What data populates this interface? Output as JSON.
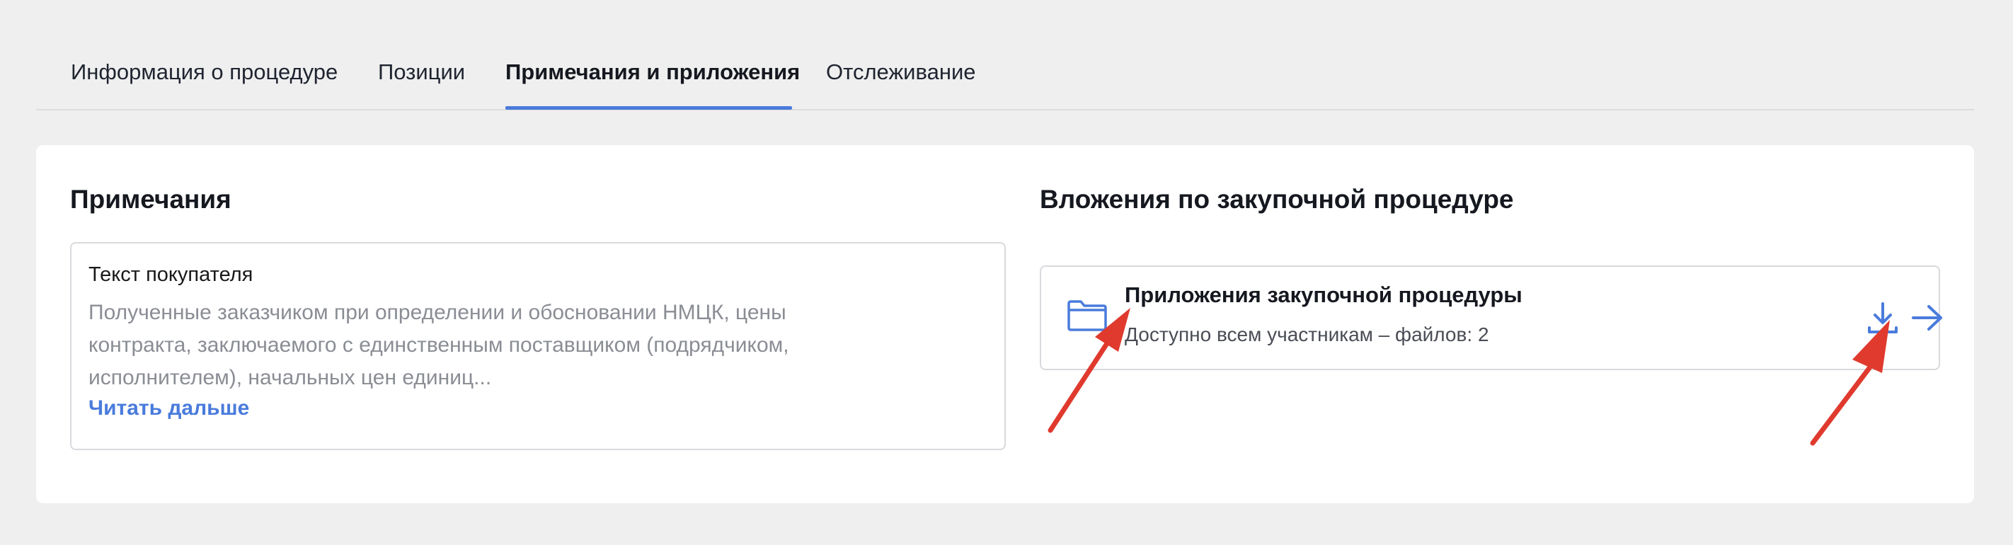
{
  "tabs": [
    {
      "label": "Информация о процедуре"
    },
    {
      "label": "Позиции"
    },
    {
      "label": "Примечания и приложения"
    },
    {
      "label": "Отслеживание"
    }
  ],
  "active_tab_index": 2,
  "notes": {
    "title": "Примечания",
    "label": "Текст покупателя",
    "text_lines": [
      "Полученные заказчиком при определении и обосновании НМЦК, цены",
      "контракта, заключаемого с единственным поставщиком (подрядчиком,",
      "исполнителем), начальных цен единиц..."
    ],
    "read_more": "Читать дальше"
  },
  "attachments": {
    "title": "Вложения по закупочной процедуре",
    "item": {
      "name": "Приложения закупочной процедуры",
      "subtitle": "Доступно всем участникам – файлов: 2",
      "icon": "folder-icon",
      "actions": [
        "download-icon",
        "arrow-right-icon"
      ]
    }
  },
  "colors": {
    "accent": "#4a7bdc",
    "annotation": "#e03a2e",
    "background": "#efefef",
    "card": "#ffffff"
  }
}
